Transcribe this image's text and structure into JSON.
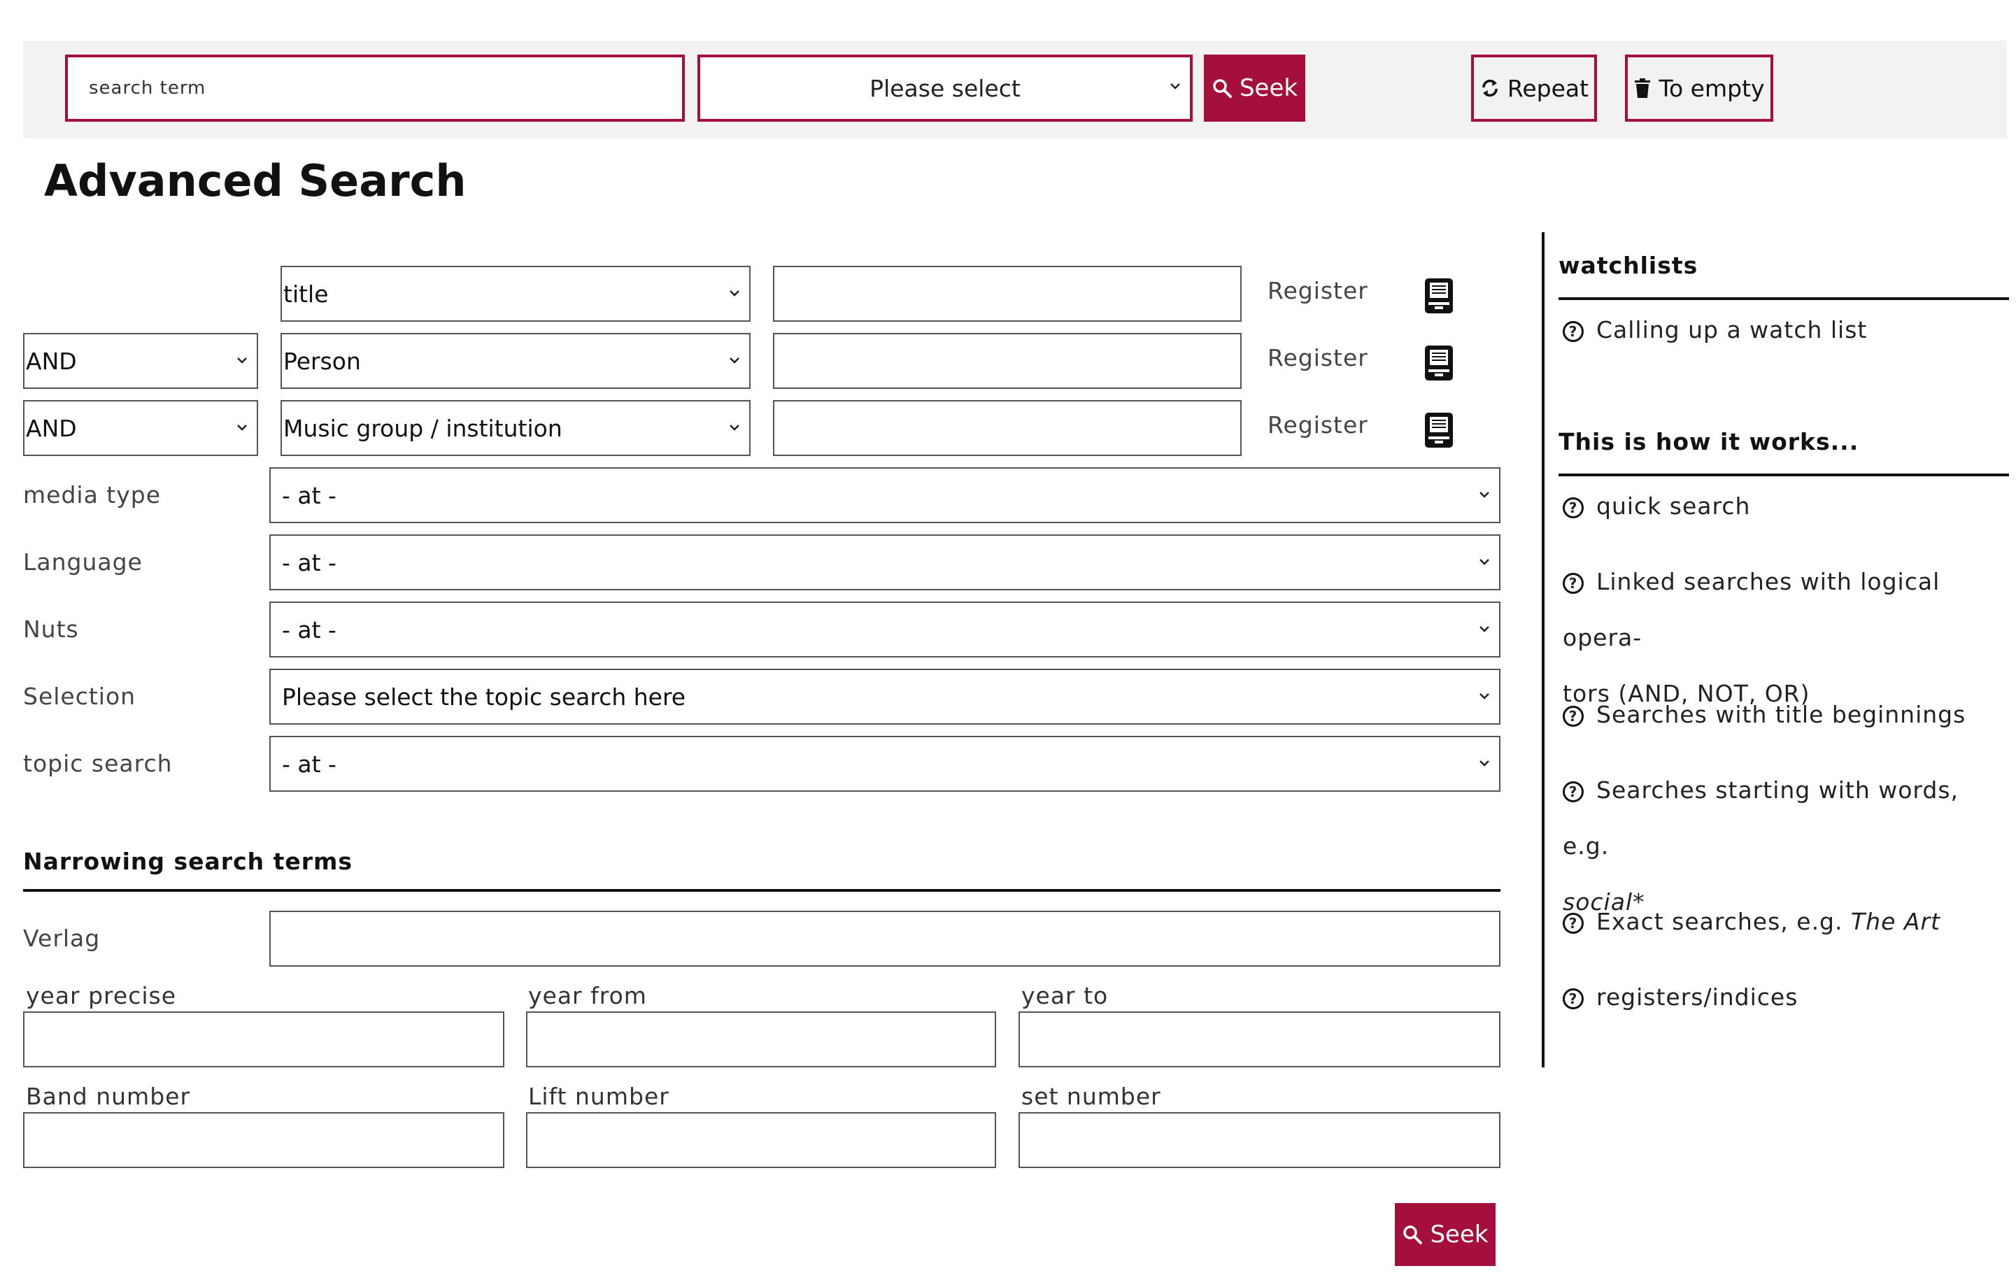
{
  "quick_search": {
    "input_placeholder": "search term",
    "select_value": "Please select",
    "seek_label": "Seek",
    "repeat_label": "Repeat",
    "empty_label": "To empty"
  },
  "page_title": "Advanced Search",
  "search_rows": [
    {
      "operator": "",
      "field": "title",
      "register": "Register"
    },
    {
      "operator": "AND",
      "field": "Person",
      "register": "Register"
    },
    {
      "operator": "AND",
      "field": "Music group / institution",
      "register": "Register"
    }
  ],
  "filters": [
    {
      "label": "media type",
      "value": "- at -"
    },
    {
      "label": "Language",
      "value": "- at -"
    },
    {
      "label": "Nuts",
      "value": "- at -"
    },
    {
      "label": "Selection",
      "value": "Please select the topic search here"
    },
    {
      "label": "topic search",
      "value": "- at -"
    }
  ],
  "narrowing": {
    "heading": "Narrowing search terms",
    "verlag_label": "Verlag",
    "year_precise": "year precise",
    "year_from": "year from",
    "year_to": "year to",
    "band_number": "Band number",
    "lift_number": "Lift number",
    "set_number": "set number"
  },
  "seek_bottom_label": "Seek",
  "sidebar": {
    "watchlists_heading": "watchlists",
    "watchlist_item": "Calling up a watch list",
    "howto_heading": "This is how it works...",
    "items": {
      "quick": "quick search",
      "linked_1": "Linked searches with logical opera-",
      "linked_2": "tors (AND, NOT, OR)",
      "title_begin": "Searches with title beginnings",
      "words_1": "Searches starting with words, e.g.",
      "words_2": "social*",
      "exact_1": "Exact searches, e.g.",
      "exact_2": "The Art",
      "registers": "registers/indices"
    }
  },
  "colors": {
    "accent": "#a50f3c"
  }
}
